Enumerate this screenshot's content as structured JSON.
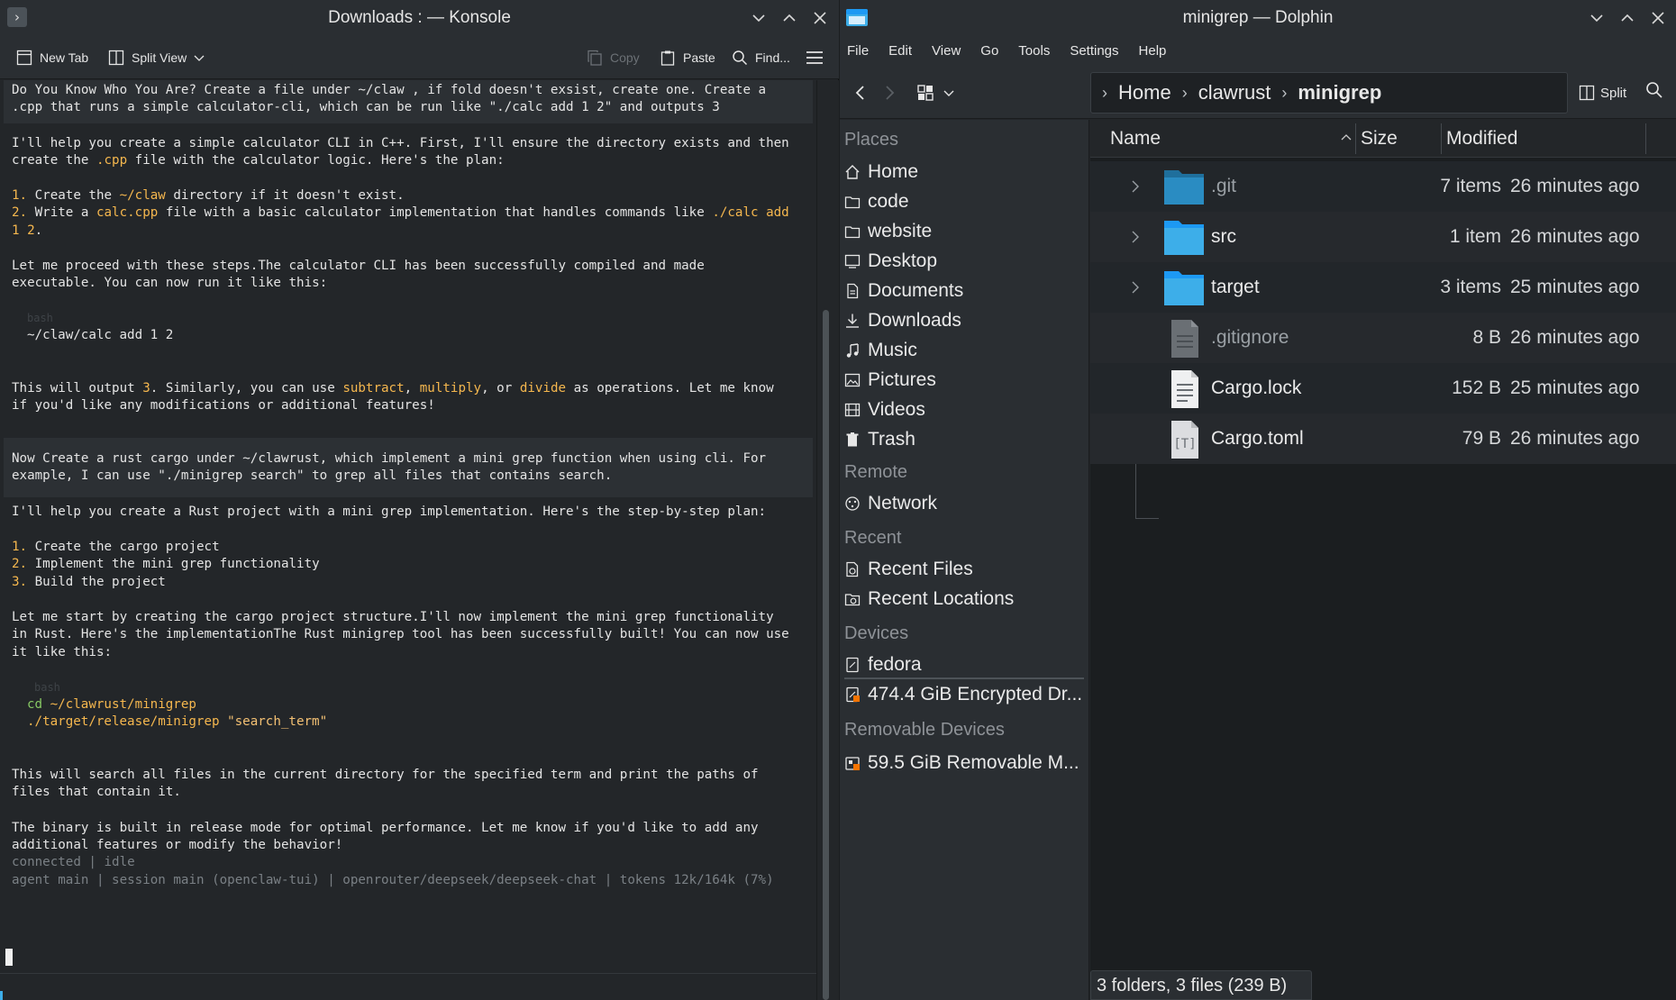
{
  "konsole": {
    "title": "Downloads : — Konsole",
    "toolbar": {
      "new_tab": "New Tab",
      "split_view": "Split View",
      "copy": "Copy",
      "paste": "Paste",
      "find": "Find..."
    },
    "lines": {
      "l1": "Do You Know Who You Are? Create a file under ~/claw , if fold doesn't exsist, create one. Create a",
      "l2": ".cpp that runs a simple calculator-cli, which can be run like \"./calc add 1 2\" and outputs 3",
      "l3": "I'll help you create a simple calculator CLI in C++. First, I'll ensure the directory exists and then",
      "l4_a": "create the ",
      "l4_b": ".cpp",
      "l4_c": " file with the calculator logic. Here's the plan:",
      "l5_n": "1.",
      "l5_a": " Create the ",
      "l5_b": "~/claw",
      "l5_c": " directory if it doesn't exist.",
      "l6_n": "2.",
      "l6_a": " Write a ",
      "l6_b": "calc.cpp",
      "l6_c": " file with a basic calculator implementation that handles commands like ",
      "l6_d": "./calc add",
      "l7": "1 2",
      "l7_b": ".",
      "l8": "Let me proceed with these steps.The calculator CLI has been successfully compiled and made",
      "l9": "executable. You can now run it like this:",
      "code1_lang": "bash",
      "code1": "~/claw/calc add 1 2",
      "l10_a": "This will output ",
      "l10_b": "3",
      "l10_c": ". Similarly, you can use ",
      "l10_d": "subtract",
      "l10_e": ", ",
      "l10_f": "multiply",
      "l10_g": ", or ",
      "l10_h": "divide",
      "l10_i": " as operations. Let me know",
      "l11": "if you'd like any modifications or additional features!",
      "l12": "Now Create a rust cargo under ~/clawrust, which implement a mini grep function when using cli. For",
      "l13": "example, I can use \"./minigrep search\" to grep all files that contains search.",
      "l14": "I'll help you create a Rust project with a mini grep implementation. Here's the step-by-step plan:",
      "l15_n": "1.",
      "l15": " Create the cargo project",
      "l16_n": "2.",
      "l16": " Implement the mini grep functionality",
      "l17_n": "3.",
      "l17": " Build the project",
      "l18": "Let me start by creating the cargo project structure.I'll now implement the mini grep functionality",
      "l19": "in Rust. Here's the implementationThe Rust minigrep tool has been successfully built! You can now use",
      "l20": "it like this:",
      "code2_lang": "bash",
      "code2_cmd": "cd",
      "code2_a": " ~/clawrust/minigrep",
      "code2_b": "./target/release/minigrep ",
      "code2_c": "\"search_term\"",
      "l21": "This will search all files in the current directory for the specified term and print the paths of",
      "l22": "files that contain it.",
      "l23": "The binary is built in release mode for optimal performance. Let me know if you'd like to add any",
      "l24": "additional features or modify the behavior!",
      "status1": "connected | idle",
      "status2": "agent main | session main (openclaw-tui) | openrouter/deepseek/deepseek-chat | tokens 12k/164k (7%)"
    }
  },
  "dolphin": {
    "title": "minigrep — Dolphin",
    "menu": [
      "File",
      "Edit",
      "View",
      "Go",
      "Tools",
      "Settings",
      "Help"
    ],
    "breadcrumb": {
      "home": "Home",
      "mid": "clawrust",
      "current": "minigrep"
    },
    "split_label": "Split",
    "places": {
      "places_head": "Places",
      "places": [
        "Home",
        "code",
        "website",
        "Desktop",
        "Documents",
        "Downloads",
        "Music",
        "Pictures",
        "Videos",
        "Trash"
      ],
      "remote_head": "Remote",
      "remote": [
        "Network"
      ],
      "recent_head": "Recent",
      "recent": [
        "Recent Files",
        "Recent Locations"
      ],
      "devices_head": "Devices",
      "devices": [
        "fedora",
        "474.4 GiB Encrypted Dr..."
      ],
      "removable_head": "Removable Devices",
      "removable": [
        "59.5 GiB Removable M..."
      ]
    },
    "columns": {
      "name": "Name",
      "size": "Size",
      "modified": "Modified"
    },
    "files": [
      {
        "name": ".git",
        "size": "7 items",
        "modified": "26 minutes ago"
      },
      {
        "name": "src",
        "size": "1 item",
        "modified": "26 minutes ago"
      },
      {
        "name": "target",
        "size": "3 items",
        "modified": "25 minutes ago"
      },
      {
        "name": ".gitignore",
        "size": "8 B",
        "modified": "26 minutes ago"
      },
      {
        "name": "Cargo.lock",
        "size": "152 B",
        "modified": "25 minutes ago"
      },
      {
        "name": "Cargo.toml",
        "size": "79 B",
        "modified": "26 minutes ago"
      }
    ],
    "status": "3 folders, 3 files (239 B)"
  },
  "colors": {
    "accent": "#3daee9",
    "folder": "#3daee9",
    "highlight": "#f5b74e",
    "green": "#87c964"
  }
}
